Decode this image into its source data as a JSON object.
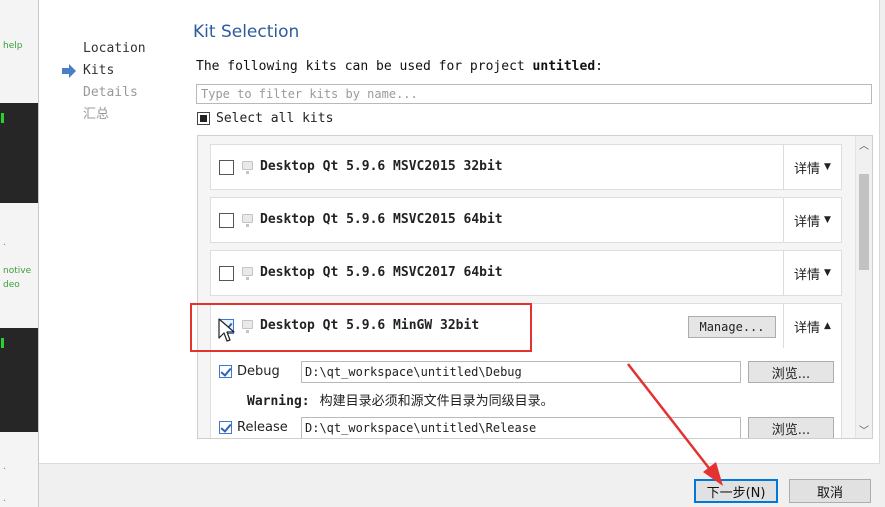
{
  "background_window": {
    "snippets": [
      "help",
      "notive",
      "deo"
    ],
    "dots": [
      ".",
      ".",
      "."
    ]
  },
  "steps": [
    {
      "label": "Location",
      "state": "done"
    },
    {
      "label": "Kits",
      "state": "active"
    },
    {
      "label": "Details",
      "state": "pending"
    },
    {
      "label": "汇总",
      "state": "pending"
    }
  ],
  "page": {
    "title": "Kit Selection",
    "intro_prefix": "The following kits can be used for project ",
    "project": "untitled",
    "intro_suffix": ":",
    "filter_placeholder": "Type to filter kits by name...",
    "filter_value": "",
    "select_all_label": "Select all kits"
  },
  "kits": [
    {
      "name": "Desktop Qt 5.9.6 MSVC2015 32bit",
      "checked": false,
      "details_label": "详情",
      "expanded": false
    },
    {
      "name": "Desktop Qt 5.9.6 MSVC2015 64bit",
      "checked": false,
      "details_label": "详情",
      "expanded": false
    },
    {
      "name": "Desktop Qt 5.9.6 MSVC2017 64bit",
      "checked": false,
      "details_label": "详情",
      "expanded": false
    },
    {
      "name": "Desktop Qt 5.9.6 MinGW 32bit",
      "checked": true,
      "details_label": "详情",
      "expanded": true,
      "manage_label": "Manage..."
    }
  ],
  "build_configs": [
    {
      "label": "Debug",
      "checked": true,
      "path": "D:\\qt_workspace\\untitled\\Debug",
      "browse_label": "浏览..."
    },
    {
      "label": "Release",
      "checked": true,
      "path": "D:\\qt_workspace\\untitled\\Release",
      "browse_label": "浏览..."
    }
  ],
  "warning": {
    "prefix": "Warning:",
    "text": "构建目录必须和源文件目录为同级目录。"
  },
  "buttons": {
    "next_label": "下一步(N)",
    "cancel_label": "取消"
  },
  "colors": {
    "title": "#2c5c9c",
    "highlight": "#e23232",
    "default_button_border": "#0078d7"
  }
}
